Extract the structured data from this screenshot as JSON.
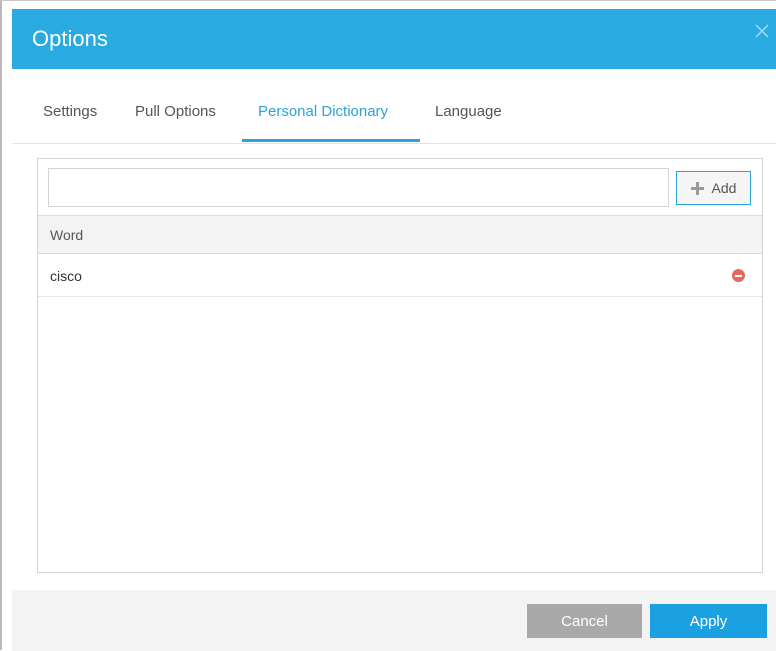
{
  "dialog": {
    "title": "Options"
  },
  "tabs": [
    {
      "label": "Settings",
      "active": false
    },
    {
      "label": "Pull Options",
      "active": false
    },
    {
      "label": "Personal Dictionary",
      "active": true
    },
    {
      "label": "Language",
      "active": false
    }
  ],
  "dictionary": {
    "input_value": "",
    "input_placeholder": "",
    "add_label": "Add",
    "column_header": "Word",
    "words": [
      "cisco"
    ]
  },
  "footer": {
    "cancel_label": "Cancel",
    "apply_label": "Apply"
  },
  "colors": {
    "accent": "#29abe2",
    "remove": "#e06a5e",
    "cancel": "#a9a9a9",
    "apply": "#1ba1e2"
  },
  "icons": {
    "close": "close-icon",
    "add": "plus-icon",
    "remove": "minus-circle-icon"
  }
}
